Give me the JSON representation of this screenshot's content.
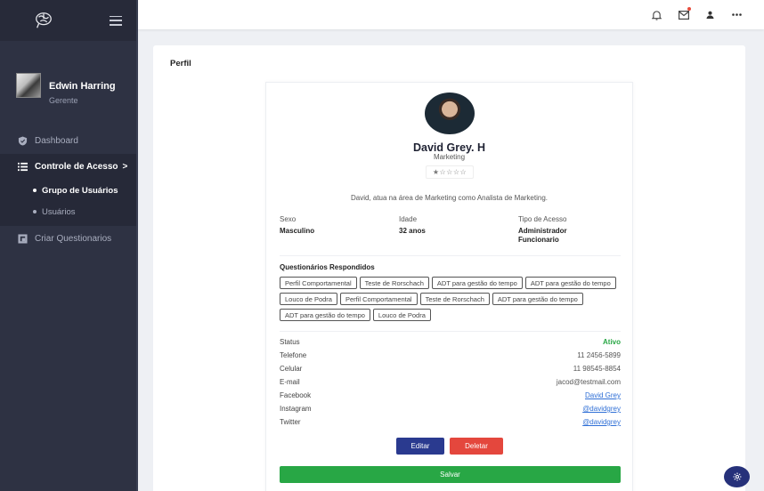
{
  "sidebar": {
    "user": {
      "name": "Edwin Harring",
      "role": "Gerente"
    },
    "items": [
      {
        "label": "Dashboard"
      },
      {
        "label": "Controle de Acesso",
        "chevron": ">"
      },
      {
        "label": "Criar Questionarios"
      }
    ],
    "subitems": [
      {
        "label": "Grupo de Usuários"
      },
      {
        "label": "Usuários"
      }
    ]
  },
  "page": {
    "title": "Perfil"
  },
  "profile": {
    "name": "David Grey. H",
    "department": "Marketing",
    "rating": {
      "value": 1,
      "max": 5,
      "display": "★☆☆☆☆"
    },
    "bio": "David, atua na área de Marketing como Analista de Marketing.",
    "info": [
      {
        "label": "Sexo",
        "value": "Masculino"
      },
      {
        "label": "Idade",
        "value": "32 anos"
      },
      {
        "label": "Tipo de Acesso",
        "value": "Administrador Funcionario"
      }
    ],
    "questionnaires_title": "Questionários Respondidos",
    "questionnaires": [
      "Perfil Comportamental",
      "Teste de Rorschach",
      "ADT para gestão do tempo",
      "ADT para gestão do tempo",
      "Louco de Podra",
      "Perfil Comportamental",
      "Teste de Rorschach",
      "ADT para gestão do tempo",
      "ADT para gestão do tempo",
      "Louco de Podra"
    ],
    "details": [
      {
        "label": "Status",
        "value": "Ativo",
        "kind": "ok"
      },
      {
        "label": "Telefone",
        "value": "11 2456-5899",
        "kind": "text"
      },
      {
        "label": "Celular",
        "value": "11 98545-8854",
        "kind": "text"
      },
      {
        "label": "E-mail",
        "value": "jacod@testmail.com",
        "kind": "text"
      },
      {
        "label": "Facebook",
        "value": "David Grey",
        "kind": "link"
      },
      {
        "label": "Instagram",
        "value": "@davidgrey",
        "kind": "link"
      },
      {
        "label": "Twitter",
        "value": "@davidgrey",
        "kind": "link"
      }
    ],
    "buttons": {
      "edit": "Editar",
      "delete": "Deletar",
      "save": "Salvar"
    }
  },
  "colors": {
    "sidebar": "#2e3243",
    "primary": "#2a3a8f",
    "danger": "#e4473d",
    "success": "#28a745",
    "link": "#2f6fd6"
  }
}
